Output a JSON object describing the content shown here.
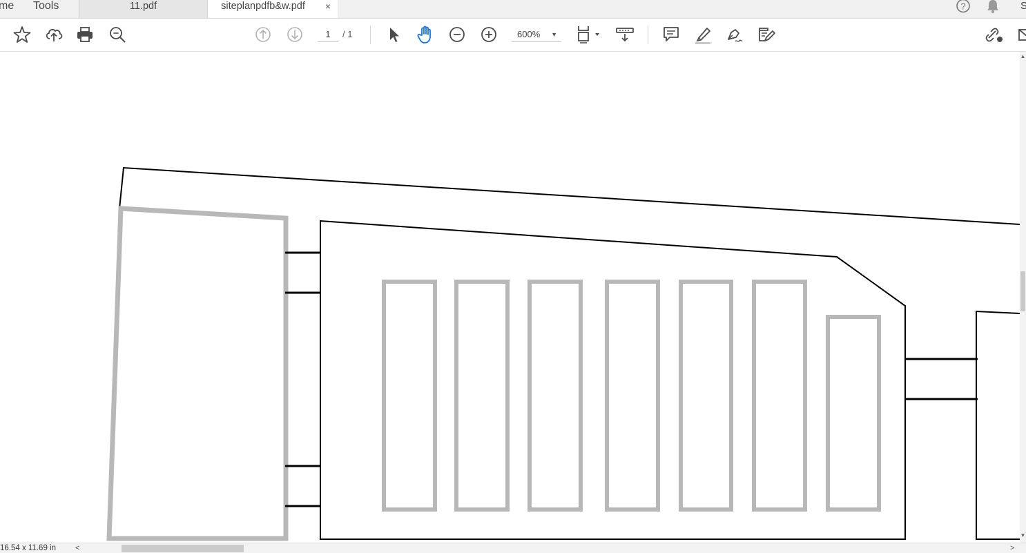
{
  "tabbar": {
    "home_label": "me",
    "tools_label": "Tools",
    "tabs": [
      {
        "label": "11.pdf"
      },
      {
        "label": "siteplanpdfb&w.pdf",
        "close": "×"
      }
    ],
    "right_partial": "S"
  },
  "toolbar": {
    "page_current": "1",
    "page_total": "/ 1",
    "zoom": "600%"
  },
  "status": {
    "page_size": "16.54 x 11.69 in",
    "scroll_left": "<",
    "scroll_right": ">"
  },
  "colors": {
    "accent": "#1473e6",
    "icon": "#4b4b4b",
    "drawing_gray": "#b8b8b8",
    "drawing_black": "#000000"
  },
  "icons": [
    "bookmark-star-icon",
    "cloud-upload-icon",
    "print-icon",
    "zoom-search-icon",
    "prev-page-icon",
    "next-page-icon",
    "select-arrow-icon",
    "hand-tool-icon",
    "zoom-out-icon",
    "zoom-in-icon",
    "fit-page-icon",
    "scroll-mode-icon",
    "comment-icon",
    "highlight-icon",
    "sign-icon",
    "edit-pdf-icon",
    "share-link-icon",
    "help-icon",
    "bell-icon"
  ]
}
